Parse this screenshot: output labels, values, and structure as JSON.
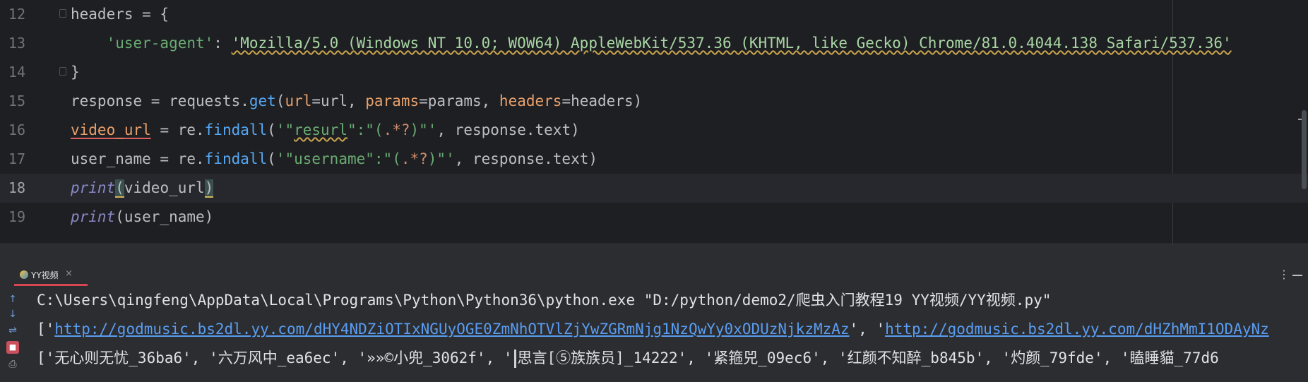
{
  "editor": {
    "lines": [
      {
        "num": "12",
        "code": "headers = {"
      },
      {
        "num": "13",
        "indent": "    ",
        "key": "'user-agent'",
        "colon": ": ",
        "value": "'Mozilla/5.0 (Windows NT 10.0; WOW64) AppleWebKit/537.36 (KHTML, like Gecko) Chrome/81.0.4044.138 Safari/537.36'"
      },
      {
        "num": "14",
        "code": "}"
      },
      {
        "num": "15",
        "p1": "response = requests.",
        "fn": "get",
        "p2": "(",
        "k1": "url",
        "p3": "=url, ",
        "k2": "params",
        "p4": "=params, ",
        "k3": "headers",
        "p5": "=headers)"
      },
      {
        "num": "16",
        "var": "video_url",
        "p1": " = re.",
        "fn": "findall",
        "p2": "(",
        "s1": "'\"",
        "s2": "resurl",
        "s3": "\":\"(",
        "sp": ".*?",
        "s4": ")\"'",
        "p3": ", response.text)"
      },
      {
        "num": "17",
        "p1": "user_name = re.",
        "fn": "findall",
        "p2": "(",
        "s1": "'\"username\":\"(",
        "sp": ".*?",
        "s4": ")\"'",
        "p3": ", response.text)"
      },
      {
        "num": "18",
        "builtin": "print",
        "open": "(",
        "arg": "video_url",
        "close": ")"
      },
      {
        "num": "19",
        "builtin": "print",
        "open": "(",
        "arg": "user_name",
        "close": ")"
      }
    ],
    "current_line": "18"
  },
  "run_panel": {
    "tab_label": "YY视频",
    "tab_close": "×",
    "more": "⋮"
  },
  "console": {
    "toolbar": {
      "up": "↑",
      "down": "↓",
      "wrap": "⇌",
      "stop": "■",
      "print": "⎙"
    },
    "line1": "C:\\Users\\qingfeng\\AppData\\Local\\Programs\\Python\\Python36\\python.exe \"D:/python/demo2/爬虫入门教程19 YY视频/YY视频.py\"",
    "line2_prefix": "['",
    "line2_link1": "http://godmusic.bs2dl.yy.com/dHY4NDZiOTIxNGUyOGE0ZmNhOTVlZjYwZGRmNjg1NzQwYy0xODUzNjkzMzAz",
    "line2_mid": "', '",
    "line2_link2": "http://godmusic.bs2dl.yy.com/dHZhMmI1ODAyNz",
    "line3_a": "['无心则无忧_36ba6', '六万风中_ea6ec', '»»©小兜_3062f', '",
    "line3_b": "思言[⑤族族员]_14222', '紧箍兕_09ec6', '红颜不知醉_b845b', '灼颜_79fde', '瞌睡貓_77d6"
  },
  "colors": {
    "editor_bg": "#1e1f22",
    "panel_bg": "#2b2d30",
    "keyword_arg": "#e8a06b",
    "string": "#6aab73",
    "function": "#56a8f5",
    "builtin": "#8888c6",
    "link": "#5a9df2",
    "tab_accent": "#d64552"
  }
}
